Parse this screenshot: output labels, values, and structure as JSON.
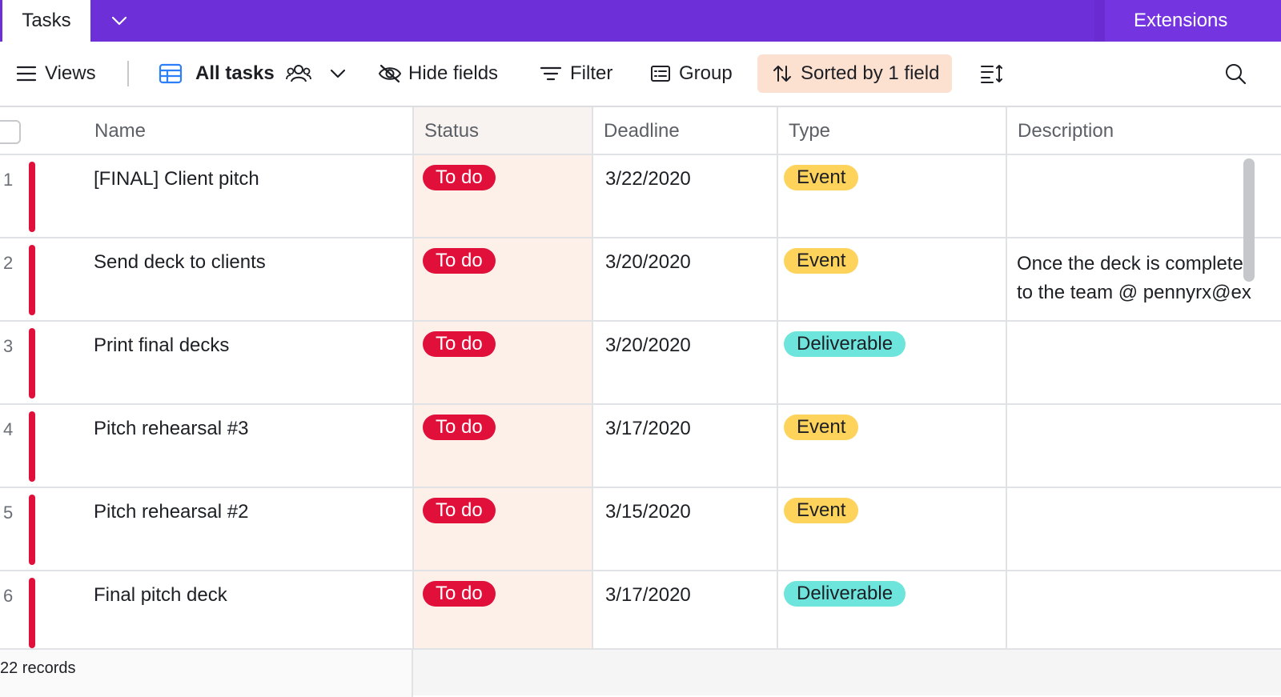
{
  "topbar": {
    "tab_label": "Tasks",
    "extensions_label": "Extensions"
  },
  "toolbar": {
    "views_label": "Views",
    "view_name": "All tasks",
    "hide_fields_label": "Hide fields",
    "filter_label": "Filter",
    "group_label": "Group",
    "sorted_label": "Sorted by 1 field"
  },
  "columns": {
    "name": "Name",
    "status": "Status",
    "deadline": "Deadline",
    "type": "Type",
    "description": "Description"
  },
  "rows": [
    {
      "num": "1",
      "name": "[FINAL] Client pitch",
      "status": "To do",
      "deadline": "3/22/2020",
      "type": "Event",
      "desc1": "",
      "desc2": ""
    },
    {
      "num": "2",
      "name": "Send deck to clients",
      "status": "To do",
      "deadline": "3/20/2020",
      "type": "Event",
      "desc1": "Once the deck is complete",
      "desc2": "to the team @ pennyrx@ex"
    },
    {
      "num": "3",
      "name": "Print final decks",
      "status": "To do",
      "deadline": "3/20/2020",
      "type": "Deliverable",
      "desc1": "",
      "desc2": ""
    },
    {
      "num": "4",
      "name": "Pitch rehearsal #3",
      "status": "To do",
      "deadline": "3/17/2020",
      "type": "Event",
      "desc1": "",
      "desc2": ""
    },
    {
      "num": "5",
      "name": "Pitch rehearsal #2",
      "status": "To do",
      "deadline": "3/15/2020",
      "type": "Event",
      "desc1": "",
      "desc2": ""
    },
    {
      "num": "6",
      "name": "Final pitch deck",
      "status": "To do",
      "deadline": "3/17/2020",
      "type": "Deliverable",
      "desc1": "",
      "desc2": ""
    }
  ],
  "footer": {
    "records_label": "22 records"
  },
  "colors": {
    "topbar": "#6c2fd8",
    "status_todo": "#e0103a",
    "type_event": "#fdd35b",
    "type_deliverable": "#6ee5dc",
    "sorted_bg": "#fde1d0"
  }
}
